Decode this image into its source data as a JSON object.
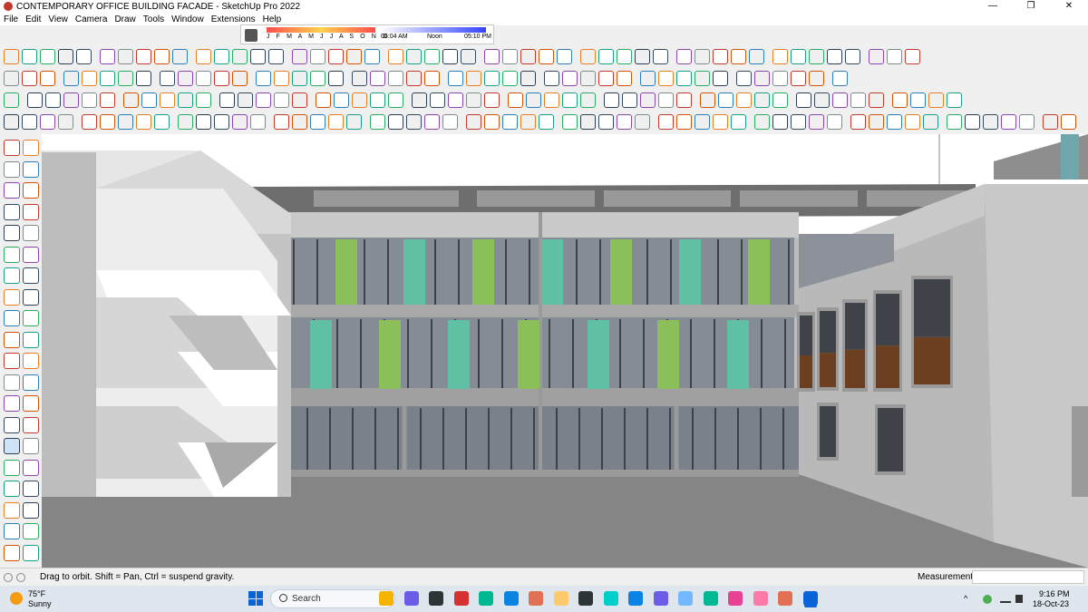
{
  "window": {
    "title": "CONTEMPORARY OFFICE BUILDING FACADE - SketchUp Pro 2022",
    "minimize_glyph": "—",
    "maximize_glyph": "❐",
    "close_glyph": "✕"
  },
  "menu": [
    "File",
    "Edit",
    "View",
    "Camera",
    "Draw",
    "Tools",
    "Window",
    "Extensions",
    "Help"
  ],
  "shadows": {
    "months": "J F M A M J J A S O N D",
    "time_start": "06:04 AM",
    "time_noon": "Noon",
    "time_end": "05:10 PM"
  },
  "colors": {
    "panel_green": "#8bbf5a",
    "panel_teal": "#5fc0a3",
    "glass": "#858c96",
    "wall": "#b9b9b9",
    "ground": "#858585",
    "sill_brown": "#6b3f1f",
    "accent_blue": "#0a64d8"
  },
  "status": {
    "hint": "Drag to orbit. Shift = Pan, Ctrl = suspend gravity.",
    "measurements_label": "Measurements",
    "measurements_value": ""
  },
  "taskbar": {
    "temperature": "75°F",
    "condition": "Sunny",
    "search_placeholder": "Search",
    "time": "9:16 PM",
    "date": "18-Oct-23",
    "tray_chevron": "^"
  }
}
